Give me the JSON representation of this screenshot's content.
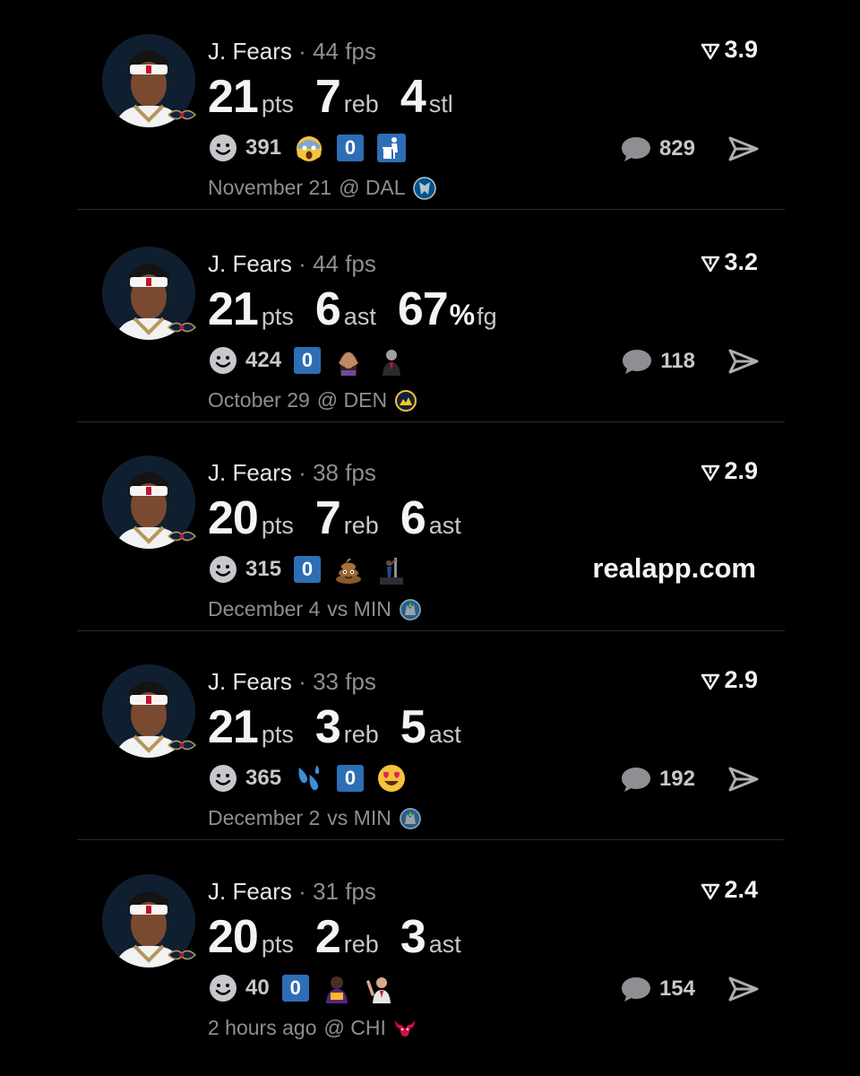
{
  "feed": {
    "brand_watermark": "realapp.com",
    "posts": [
      {
        "player": "J. Fears",
        "separator": "·",
        "fps": "44 fps",
        "rating": "3.9",
        "stats": [
          {
            "value": "21",
            "unit": "pts"
          },
          {
            "value": "7",
            "unit": "reb"
          },
          {
            "value": "4",
            "unit": "stl"
          }
        ],
        "smile_count": "391",
        "zero_badge": "0",
        "reaction_icons": [
          "scream-emoji-icon",
          "trash-can-icon"
        ],
        "comment_count": "829",
        "game_date": "November 21",
        "game_location": "@ DAL",
        "team_logo_icon": "mavericks-logo-icon"
      },
      {
        "player": "J. Fears",
        "separator": "·",
        "fps": "44 fps",
        "rating": "3.2",
        "stats": [
          {
            "value": "21",
            "unit": "pts"
          },
          {
            "value": "6",
            "unit": "ast"
          },
          {
            "value": "67",
            "unit": "fg",
            "suffix": "%"
          }
        ],
        "smile_count": "424",
        "zero_badge": "0",
        "reaction_icons": [
          "shocked-person-sticker-icon",
          "referee-sticker-icon"
        ],
        "comment_count": "118",
        "game_date": "October 29",
        "game_location": "@ DEN",
        "team_logo_icon": "nuggets-logo-icon"
      },
      {
        "player": "J. Fears",
        "separator": "·",
        "fps": "38 fps",
        "rating": "2.9",
        "stats": [
          {
            "value": "20",
            "unit": "pts"
          },
          {
            "value": "7",
            "unit": "reb"
          },
          {
            "value": "6",
            "unit": "ast"
          }
        ],
        "smile_count": "315",
        "zero_badge": "0",
        "reaction_icons": [
          "poop-emoji-icon",
          "dunk-sticker-icon"
        ],
        "comment_count": "",
        "game_date": "December 4",
        "game_location": "vs MIN",
        "team_logo_icon": "timberwolves-logo-icon"
      },
      {
        "player": "J. Fears",
        "separator": "·",
        "fps": "33 fps",
        "rating": "2.9",
        "stats": [
          {
            "value": "21",
            "unit": "pts"
          },
          {
            "value": "3",
            "unit": "reb"
          },
          {
            "value": "5",
            "unit": "ast"
          }
        ],
        "smile_count": "365",
        "zero_badge": "0",
        "reaction_icons": [
          "sweat-droplets-emoji-icon",
          "heart-eyes-emoji-icon"
        ],
        "comment_count": "192",
        "game_date": "December 2",
        "game_location": "vs MIN",
        "team_logo_icon": "timberwolves-logo-icon"
      },
      {
        "player": "J. Fears",
        "separator": "·",
        "fps": "31 fps",
        "rating": "2.4",
        "stats": [
          {
            "value": "20",
            "unit": "pts"
          },
          {
            "value": "2",
            "unit": "reb"
          },
          {
            "value": "3",
            "unit": "ast"
          }
        ],
        "smile_count": "40",
        "zero_badge": "0",
        "reaction_icons": [
          "lebron-sticker-icon",
          "waving-man-sticker-icon"
        ],
        "comment_count": "154",
        "game_date": "2 hours ago",
        "game_location": "@ CHI",
        "team_logo_icon": "bulls-logo-icon"
      }
    ]
  },
  "colors": {
    "background": "#000000",
    "primary_text": "#f4f4f5",
    "secondary_text": "#8e8e93",
    "badge_blue": "#2d6eb5",
    "divider": "#2a2a2c"
  }
}
